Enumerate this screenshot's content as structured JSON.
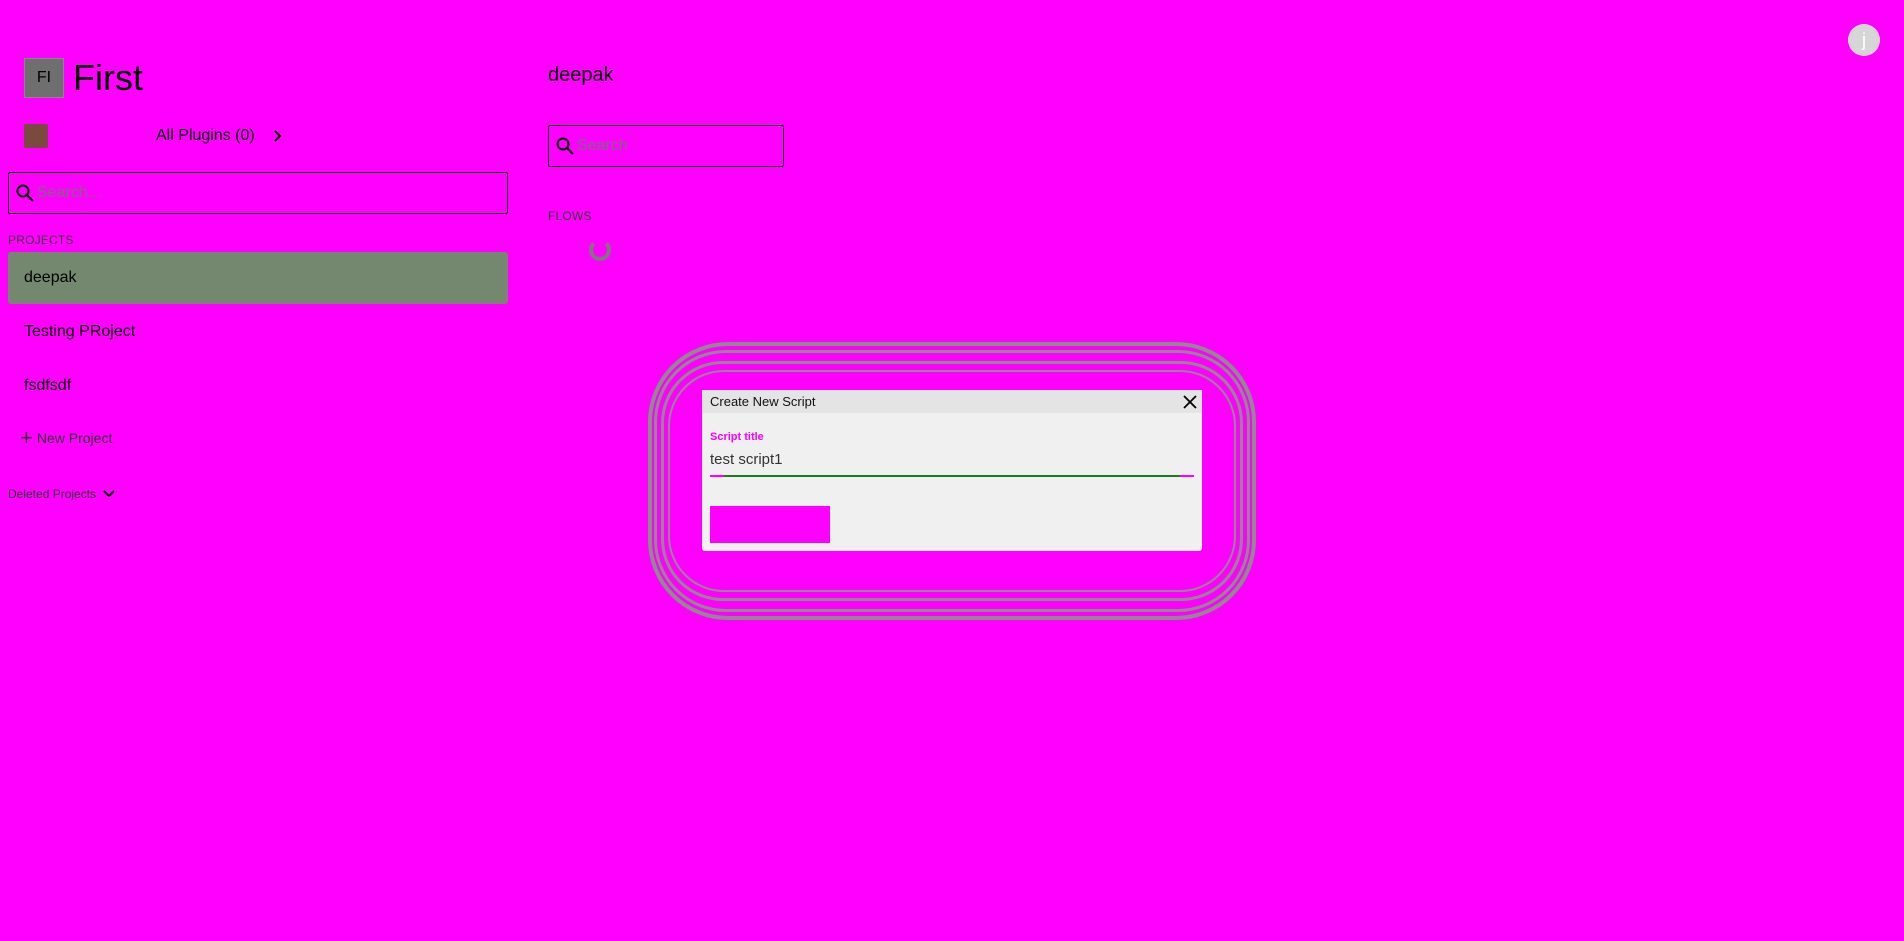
{
  "user": {
    "avatar_initial": "j"
  },
  "sidebar": {
    "workspace_badge": "FI",
    "workspace_title": "First",
    "plugins_label": "All Plugins (0)",
    "search_placeholder": "Search...",
    "projects_heading": "PROJECTS",
    "projects": [
      {
        "name": "deepak",
        "active": true
      },
      {
        "name": "Testing PRoject",
        "active": false
      },
      {
        "name": "fsdfsdf",
        "active": false
      }
    ],
    "new_project_label": "New Project",
    "deleted_projects_label": "Deleted Projects"
  },
  "main": {
    "title": "deepak",
    "search_placeholder": "Search",
    "flows_heading": "FLOWS"
  },
  "modal": {
    "title": "Create New Script",
    "field_label": "Script title",
    "field_value": "test script1",
    "submit_label": ""
  },
  "colors": {
    "background": "#ff00ff",
    "active_project": "#74876f",
    "modal_background": "#f0f0f0",
    "input_underline": "#1e7a1e"
  }
}
